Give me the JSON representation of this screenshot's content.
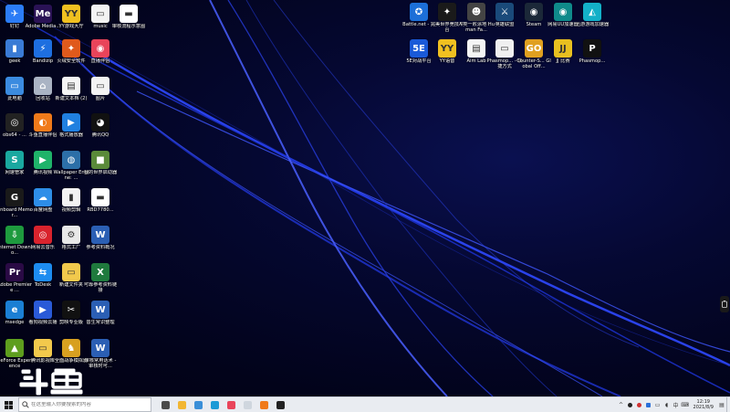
{
  "desktop_left": [
    {
      "label": "钉钉",
      "color": "#2b7cf6",
      "glyph": "✈",
      "name": "dingtalk-shortcut"
    },
    {
      "label": "Adobe Media...",
      "color": "#2a1255",
      "glyph": "Me",
      "name": "adobe-media-encoder-shortcut"
    },
    {
      "label": "YY游戏大厅",
      "color": "#f0c020",
      "glyph": "YY",
      "name": "yy-game-hall-shortcut"
    },
    {
      "label": "music",
      "color": "#f3f3f3",
      "glyph": "▭",
      "name": "music-folder"
    },
    {
      "label": "审核流程示意图",
      "color": "#ffffff",
      "glyph": "▬",
      "name": "review-flowchart-file"
    },
    {
      "label": "geek",
      "color": "#3a7bd5",
      "glyph": "▮",
      "name": "geek-shortcut"
    },
    {
      "label": "Bandizip",
      "color": "#1e6fe0",
      "glyph": "⚡",
      "name": "bandizip-shortcut"
    },
    {
      "label": "火绒安全软件",
      "color": "#e05a1c",
      "glyph": "✦",
      "name": "huorong-shortcut"
    },
    {
      "label": "直播伴侣",
      "color": "#e9445a",
      "glyph": "◉",
      "name": "live-companion-shortcut"
    },
    {
      "label": "此电脑",
      "color": "#3b8be0",
      "glyph": "▭",
      "name": "this-pc-icon"
    },
    {
      "label": "回收站",
      "color": "#aab4c4",
      "glyph": "⌂",
      "name": "recycle-bin-icon"
    },
    {
      "label": "新建文本档 (2)",
      "color": "#f5f5f5",
      "glyph": "▤",
      "name": "new-text-file-2"
    },
    {
      "label": "图片",
      "color": "#f3f3f3",
      "glyph": "▭",
      "name": "pictures-folder"
    },
    {
      "label": "obs64 - ...",
      "color": "#222222",
      "glyph": "◎",
      "name": "obs64-shortcut"
    },
    {
      "label": "斗鱼直播伴侣",
      "color": "#f07a1a",
      "glyph": "◐",
      "name": "douyu-live-companion-shortcut"
    },
    {
      "label": "格式播放器",
      "color": "#2080e0",
      "glyph": "▶",
      "name": "format-player-shortcut"
    },
    {
      "label": "腾讯QQ",
      "color": "#111111",
      "glyph": "◕",
      "name": "tencent-qq-shortcut"
    },
    {
      "label": "网速管家",
      "color": "#1aa8a0",
      "glyph": "S",
      "name": "net-speed-manager-shortcut"
    },
    {
      "label": "腾讯视频",
      "color": "#1fb36a",
      "glyph": "▶",
      "name": "tencent-video-shortcut"
    },
    {
      "label": "Wallpaper Engine: ...",
      "color": "#2c6fa8",
      "glyph": "◍",
      "name": "wallpaper-engine-shortcut"
    },
    {
      "label": "我的世界启动器",
      "color": "#5a8a3a",
      "glyph": "■",
      "name": "minecraft-launcher-shortcut"
    },
    {
      "label": "Onboard Memor...",
      "color": "#1a1a1a",
      "glyph": "G",
      "name": "onboard-memory-shortcut"
    },
    {
      "label": "百度网盘",
      "color": "#2e8ee8",
      "glyph": "☁",
      "name": "baidu-netdisk-shortcut"
    },
    {
      "label": "视频剪辑",
      "color": "#f3f3f3",
      "glyph": "▮",
      "name": "video-editing-file"
    },
    {
      "label": "RBD7780...",
      "color": "#ffffff",
      "glyph": "▬",
      "name": "rbd7780-file"
    },
    {
      "label": "Internet Downlo...",
      "color": "#1e9a3e",
      "glyph": "⇩",
      "name": "internet-download-manager-shortcut"
    },
    {
      "label": "网易云音乐",
      "color": "#d9232d",
      "glyph": "◎",
      "name": "netease-music-shortcut"
    },
    {
      "label": "格式工厂",
      "color": "#e8e8e8",
      "glyph": "⚙",
      "name": "format-factory-shortcut"
    },
    {
      "label": "参考资料概况",
      "color": "#2b5fb4",
      "glyph": "W",
      "name": "reference-doc-file"
    },
    {
      "label": "Adobe Premiere ...",
      "color": "#2a0a45",
      "glyph": "Pr",
      "name": "adobe-premiere-shortcut"
    },
    {
      "label": "ToDesk",
      "color": "#1d8cf0",
      "glyph": "⇆",
      "name": "todesk-shortcut"
    },
    {
      "label": "新建文件夹",
      "color": "#f2c94c",
      "glyph": "▭",
      "name": "new-folder"
    },
    {
      "label": "可靠参考资料链接",
      "color": "#1f7a3d",
      "glyph": "X",
      "name": "reference-links-xlsx"
    },
    {
      "label": "msedge",
      "color": "#1b7fd4",
      "glyph": "e",
      "name": "msedge-shortcut"
    },
    {
      "label": "看狗视频云播",
      "color": "#2a5ad8",
      "glyph": "▶",
      "name": "video-cloud-player-shortcut"
    },
    {
      "label": "剪映专业版",
      "color": "#111111",
      "glyph": "✂",
      "name": "jianying-pro-shortcut"
    },
    {
      "label": "音生常识整理",
      "color": "#2b5fb4",
      "glyph": "W",
      "name": "notes-doc-file"
    },
    {
      "label": "GeForce Experience",
      "color": "#5e9e1e",
      "glyph": "▲",
      "name": "geforce-experience-shortcut"
    },
    {
      "label": "腾讯影视库",
      "color": "#f2c94c",
      "glyph": "▭",
      "name": "tencent-video-library-folder"
    },
    {
      "label": "全面战争模拟器",
      "color": "#d8a020",
      "glyph": "♞",
      "name": "totally-accurate-battle-simulator-shortcut"
    },
    {
      "label": "审核常用话术 - 审核时可...",
      "color": "#2b5fb4",
      "glyph": "W",
      "name": "review-scripts-doc-file"
    }
  ],
  "desktop_right": [
    {
      "label": "Battle.net - ...",
      "color": "#1c6fd8",
      "glyph": "✪",
      "name": "battlenet-shortcut"
    },
    {
      "label": "完美世界竞技平台",
      "color": "#1a1a1a",
      "glyph": "✦",
      "name": "perfect-world-arena-shortcut"
    },
    {
      "label": "人类一败涂地 Human Fa...",
      "color": "#444444",
      "glyph": "☻",
      "name": "human-fall-flat-shortcut"
    },
    {
      "label": "英雄联盟",
      "color": "#1a4a7a",
      "glyph": "⚔",
      "name": "league-of-legends-shortcut"
    },
    {
      "label": "Steam",
      "color": "#1b2838",
      "glyph": "◉",
      "name": "steam-shortcut"
    },
    {
      "label": "网易UU加速器",
      "color": "#0f8a8a",
      "glyph": "◉",
      "name": "netease-uu-accelerator-shortcut"
    },
    {
      "label": "迅游游戏加速器",
      "color": "#13b0c8",
      "glyph": "◭",
      "name": "xunyou-accelerator-shortcut"
    },
    {
      "label": "5E对战平台",
      "color": "#1a5ad8",
      "glyph": "5E",
      "name": "5e-platform-shortcut"
    },
    {
      "label": "YY语音",
      "color": "#f0c020",
      "glyph": "YY",
      "name": "yy-voice-shortcut"
    },
    {
      "label": "Aim Lab",
      "color": "#f5f5f5",
      "glyph": "▤",
      "name": "aim-lab-shortcut"
    },
    {
      "label": "Phasmop... - 快捷方式",
      "color": "#f0f0f0",
      "glyph": "▭",
      "name": "phasmophobia-shortcut-file"
    },
    {
      "label": "Counter-S... Global Off...",
      "color": "#e0a020",
      "glyph": "GO",
      "name": "csgo-shortcut"
    },
    {
      "label": "JJ 比赛",
      "color": "#e8c020",
      "glyph": "JJ",
      "name": "jj-competition-shortcut"
    },
    {
      "label": "Phasmop...",
      "color": "#111111",
      "glyph": "P",
      "name": "phasmophobia-shortcut"
    }
  ],
  "taskbar": {
    "search_placeholder": "在这里输入你要搜索的内容",
    "start_icon": "windows-logo-icon",
    "apps": [
      {
        "name": "taskbar-task-view",
        "color": "#4a4a4a"
      },
      {
        "name": "taskbar-file-explorer",
        "color": "#f2b632"
      },
      {
        "name": "taskbar-app-screen",
        "color": "#3a8fd8"
      },
      {
        "name": "taskbar-edge",
        "color": "#1b9ad6"
      },
      {
        "name": "taskbar-live-companion",
        "color": "#e9445a"
      },
      {
        "name": "taskbar-notepad",
        "color": "#cfd6de"
      },
      {
        "name": "taskbar-douyu",
        "color": "#f07a1a"
      },
      {
        "name": "taskbar-obs",
        "color": "#222222"
      }
    ],
    "clock_time": "12:19",
    "clock_date": "2021/8/9"
  },
  "watermark": {
    "text": "斗鱼"
  }
}
